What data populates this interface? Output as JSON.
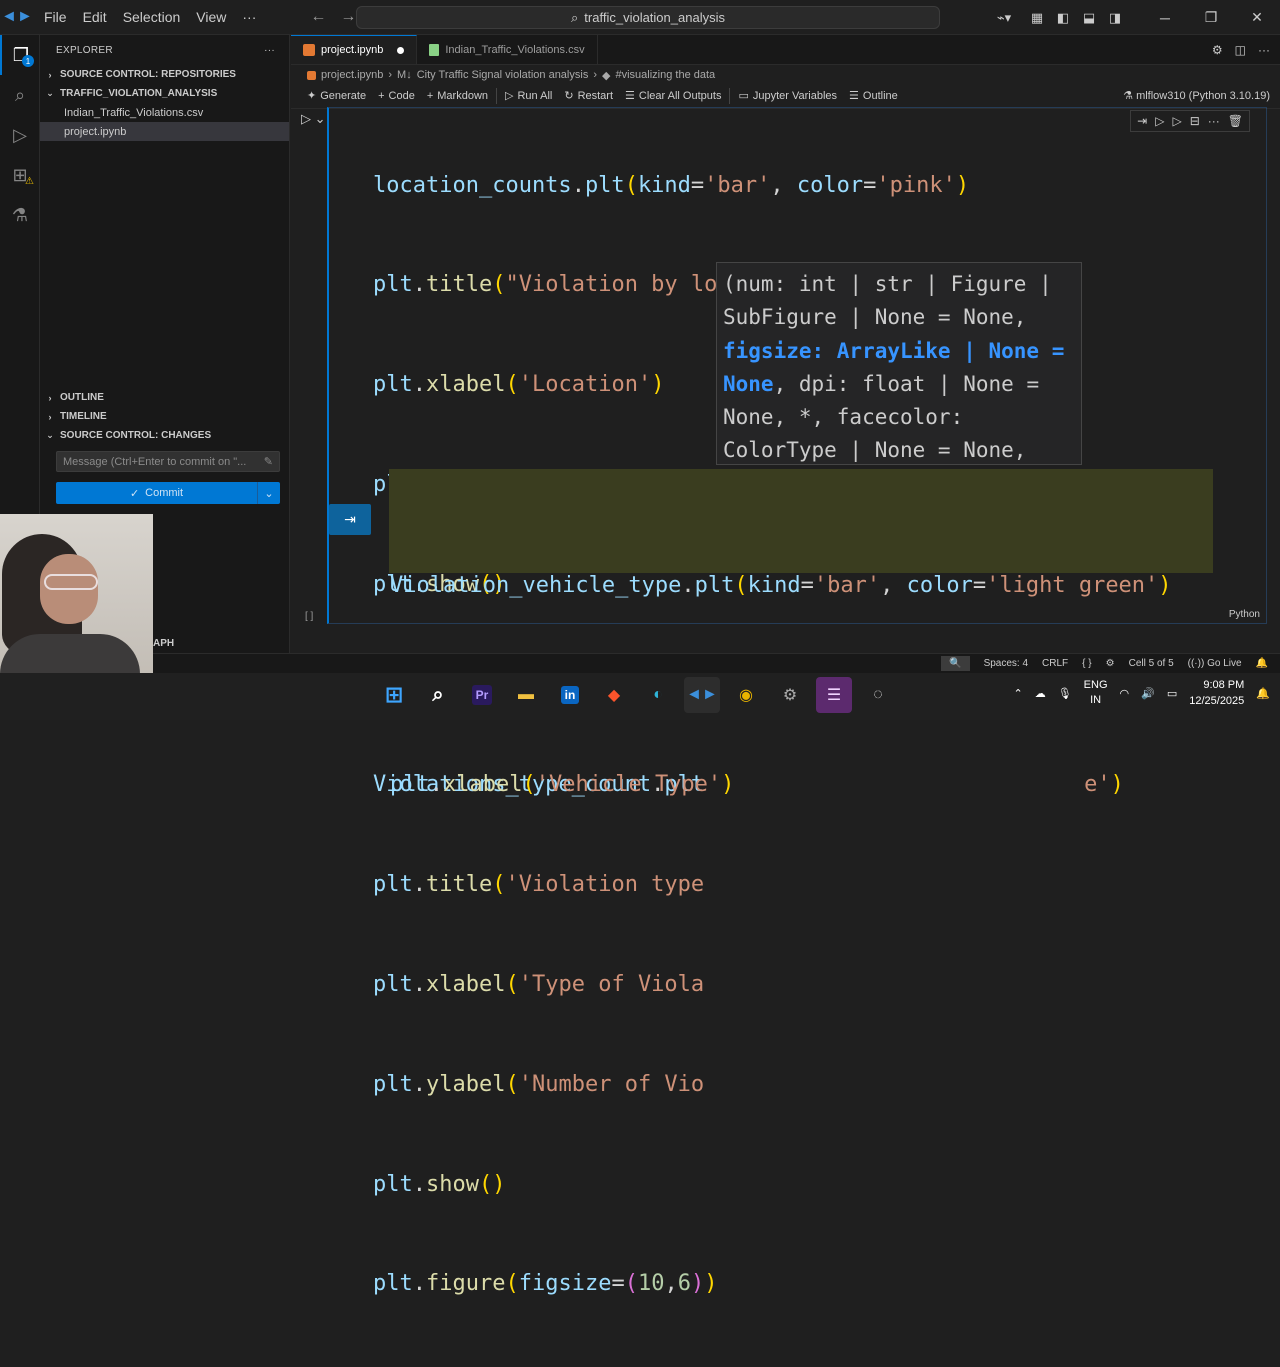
{
  "titlebar": {
    "menu": [
      "File",
      "Edit",
      "Selection",
      "View",
      "···"
    ],
    "search": "traffic_violation_analysis"
  },
  "sidebar": {
    "header": "EXPLORER",
    "repos_section": "SOURCE CONTROL: REPOSITORIES",
    "folder": "TRAFFIC_VIOLATION_ANALYSIS",
    "files": [
      "Indian_Traffic_Violations.csv",
      "project.ipynb"
    ],
    "outline": "OUTLINE",
    "timeline": "TIMELINE",
    "changes_section": "SOURCE CONTROL: CHANGES",
    "commit_placeholder": "Message (Ctrl+Enter to commit on \"...",
    "commit_label": "Commit",
    "graph_label": "APH"
  },
  "tabs": [
    {
      "label": "project.ipynb",
      "active": true
    },
    {
      "label": "Indian_Traffic_Violations.csv",
      "active": false
    }
  ],
  "breadcrumb": [
    "project.ipynb",
    "City Traffic Signal violation analysis",
    "#visualizing the data"
  ],
  "toolbar": {
    "generate": "Generate",
    "code": "Code",
    "markdown": "Markdown",
    "run_all": "Run All",
    "restart": "Restart",
    "clear": "Clear All Outputs",
    "variables": "Jupyter Variables",
    "outline": "Outline",
    "kernel": "mlflow310 (Python 3.10.19)"
  },
  "cell": {
    "gutter": "[ ]",
    "language": "Python"
  },
  "hover": {
    "part1": "(num: int | str | Figure | SubFigure | None = None, ",
    "highlight": "figsize: ArrayLike | None = None",
    "part2": ", dpi: float | None = None, *, facecolor: ColorType | None = None,"
  },
  "statusbar": {
    "spaces": "Spaces: 4",
    "eol": "CRLF",
    "braces": "{ }",
    "cell": "Cell 5 of 5",
    "golive": "Go Live"
  },
  "taskbar": {
    "lang1": "ENG",
    "lang2": "IN",
    "time": "9:08 PM",
    "date": "12/25/2025"
  }
}
